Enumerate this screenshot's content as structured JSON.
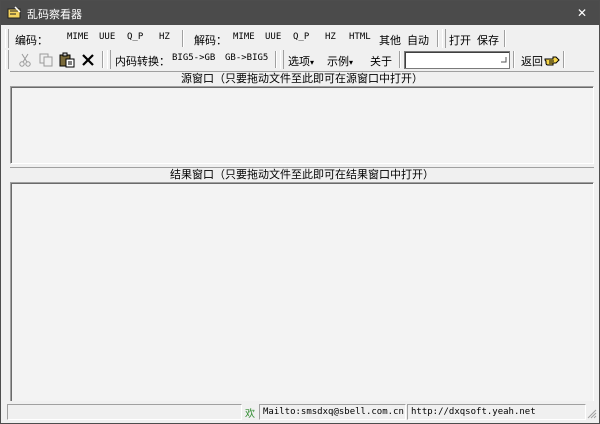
{
  "window": {
    "title": "乱码察看器",
    "close_glyph": "✕"
  },
  "encode_bar": {
    "label": "编码：",
    "buttons": [
      "MIME",
      "UUE",
      "Q_P",
      "HZ"
    ]
  },
  "decode_bar": {
    "label": "解码：",
    "buttons": [
      "MIME",
      "UUE",
      "Q_P",
      "HZ",
      "HTML"
    ],
    "other": "其他",
    "auto": "自动"
  },
  "file_bar": {
    "open": "打开",
    "save": "保存"
  },
  "edit_bar": {
    "icons": [
      "cut-icon",
      "copy-icon",
      "paste-icon",
      "clear-icon"
    ]
  },
  "convert_bar": {
    "label": "内码转换：",
    "big5_to_gb": "BIG5->GB",
    "gb_to_big5": "GB->BIG5"
  },
  "menu_bar": {
    "options": "选项",
    "examples": "示例",
    "about": "关于",
    "dropdown_glyph": "▾",
    "combo_value": ""
  },
  "back": {
    "label": "返回"
  },
  "source_pane": {
    "header": "源窗口（只要拖动文件至此即可在源窗口中打开）",
    "content": ""
  },
  "result_pane": {
    "header": "结果窗口（只要拖动文件至此即可在结果窗口中打开）",
    "content": ""
  },
  "status": {
    "mark": "欢",
    "mail": "Mailto:smsdxq@sbell.com.cn",
    "url": "http://dxqsoft.yeah.net"
  }
}
